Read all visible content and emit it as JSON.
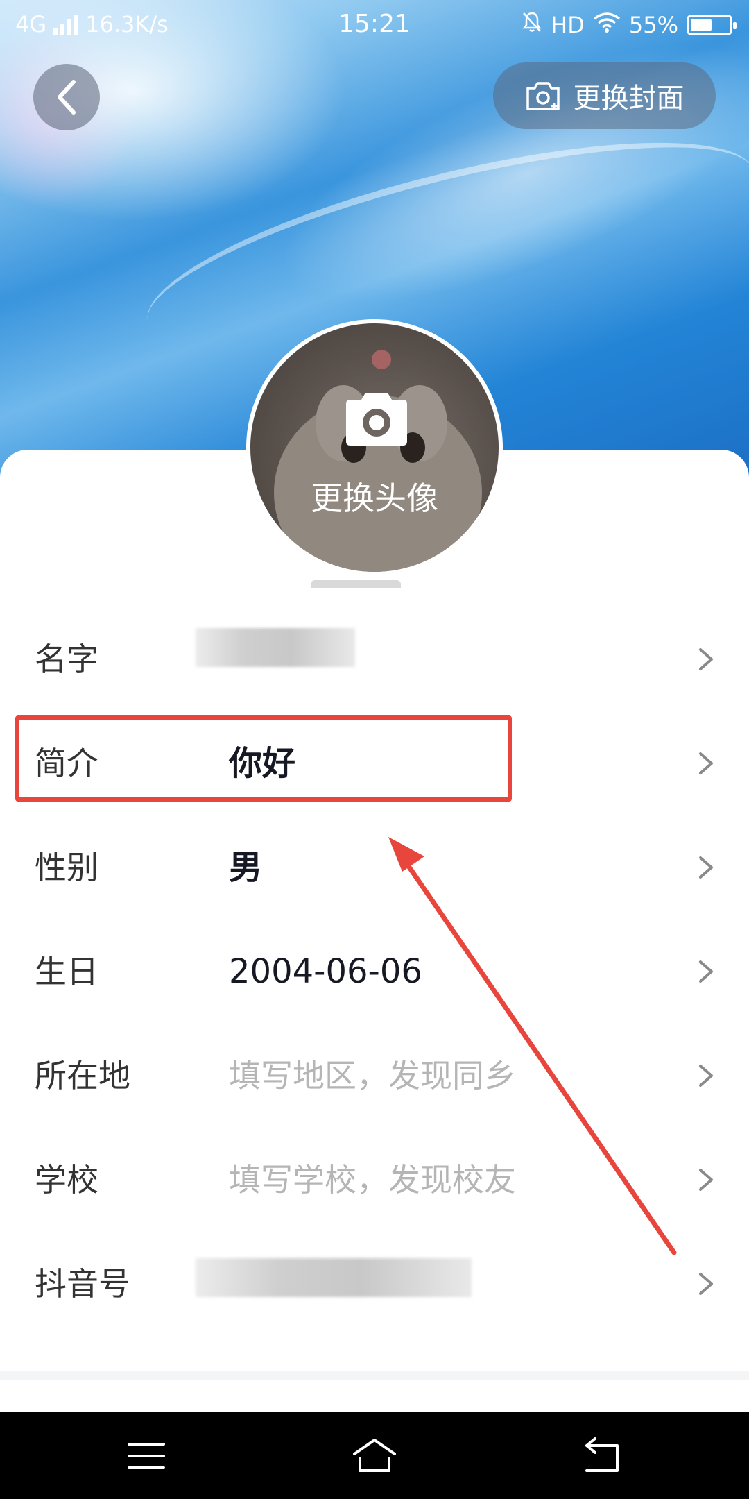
{
  "status_bar": {
    "network": "4G",
    "speed": "16.3K/s",
    "time": "15:21",
    "hd": "HD",
    "battery": "55%",
    "battery_level": 0.55
  },
  "header": {
    "change_cover_label": "更换封面"
  },
  "avatar": {
    "change_label": "更换头像"
  },
  "fields": {
    "name": {
      "label": "名字"
    },
    "bio": {
      "label": "简介",
      "value": "你好"
    },
    "gender": {
      "label": "性别",
      "value": "男"
    },
    "birthday": {
      "label": "生日",
      "value": "2004-06-06"
    },
    "location": {
      "label": "所在地",
      "placeholder": "填写地区，发现同乡"
    },
    "school": {
      "label": "学校",
      "placeholder": "填写学校，发现校友"
    },
    "douyin_id": {
      "label": "抖音号"
    }
  },
  "colors": {
    "highlight": "#e8453c",
    "value_text": "#161823",
    "placeholder_text": "#b5b5b5"
  }
}
